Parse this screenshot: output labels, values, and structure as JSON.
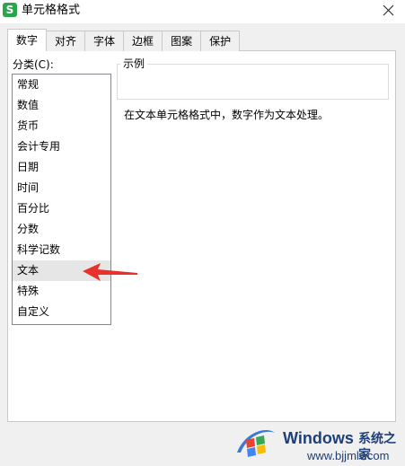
{
  "window": {
    "title": "单元格格式",
    "app_icon_letter": "S",
    "close_icon": "close-icon"
  },
  "tabs": [
    {
      "label": "数字",
      "active": true
    },
    {
      "label": "对齐",
      "active": false
    },
    {
      "label": "字体",
      "active": false
    },
    {
      "label": "边框",
      "active": false
    },
    {
      "label": "图案",
      "active": false
    },
    {
      "label": "保护",
      "active": false
    }
  ],
  "category": {
    "label": "分类(C):",
    "items": [
      "常规",
      "数值",
      "货币",
      "会计专用",
      "日期",
      "时间",
      "百分比",
      "分数",
      "科学记数",
      "文本",
      "特殊",
      "自定义"
    ],
    "selected": "文本"
  },
  "preview": {
    "legend": "示例",
    "value": ""
  },
  "description": "在文本单元格格式中，数字作为文本处理。",
  "annotation": {
    "arrow_color": "#e8312a",
    "arrow_icon": "red-arrow-icon"
  },
  "watermark": {
    "brand": "Windows",
    "site_name": "系统之家",
    "url": "www.bjjmlv.com"
  },
  "colors": {
    "app_icon": "#2aa54b",
    "watermark_text": "#1e3f78",
    "selected_bg": "#e6e6e6",
    "dialog_bg": "#f0f0f0"
  }
}
